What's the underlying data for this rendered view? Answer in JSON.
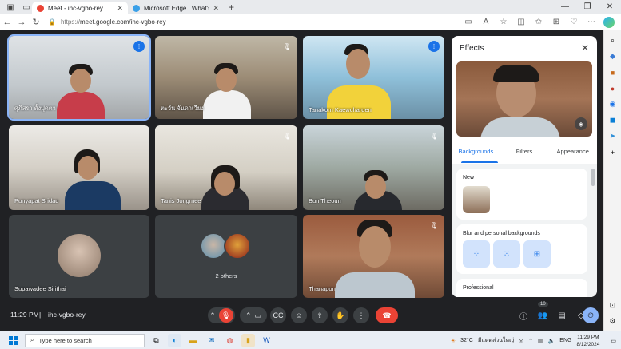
{
  "browser": {
    "tabs": [
      {
        "title": "Meet - ihc-vgbo-rey",
        "active": true,
        "favicon_color": "#ea4335"
      },
      {
        "title": "Microsoft Edge | What's New",
        "active": false,
        "favicon_color": "#3aa0e8"
      }
    ],
    "new_tab": "+",
    "window_controls": {
      "minimize": "—",
      "maximize": "❐",
      "close": "✕"
    },
    "url": {
      "scheme": "https://",
      "host_path": "meet.google.com/ihc-vgbo-rey"
    }
  },
  "participants": [
    {
      "name": "ศุภิสรา ตั้งปุดตา",
      "speaking": true
    },
    {
      "name": "ตะวัน จันดาเวียง",
      "speaking": false
    },
    {
      "name": "Tanakorn Kaewcharoen",
      "speaking": true
    },
    {
      "name": "Punyapat Sridao",
      "speaking": false
    },
    {
      "name": "Tanis Jongmee",
      "speaking": false
    },
    {
      "name": "Bun Theoun",
      "speaking": false
    },
    {
      "name": "Supawadee Sirithai",
      "speaking": false
    },
    {
      "name": "2 others",
      "speaking": false
    },
    {
      "name": "Thanapon",
      "speaking": false
    }
  ],
  "effects": {
    "title": "Effects",
    "tabs": [
      "Backgrounds",
      "Filters",
      "Appearance"
    ],
    "selected_tab": "Backgrounds",
    "sections": [
      {
        "label": "New"
      },
      {
        "label": "Blur and personal backgrounds"
      },
      {
        "label": "Professional"
      }
    ]
  },
  "meeting": {
    "time": "11:29 PM",
    "separator": "|",
    "code": "ihc-vgbo-rey",
    "participant_count": "10"
  },
  "taskbar": {
    "search_placeholder": "Type here to search",
    "weather": "32°C",
    "weather_text": "มีแดดส่วนใหญ่",
    "language": "ENG",
    "clock_time": "11:29 PM",
    "clock_date": "8/12/2024"
  }
}
